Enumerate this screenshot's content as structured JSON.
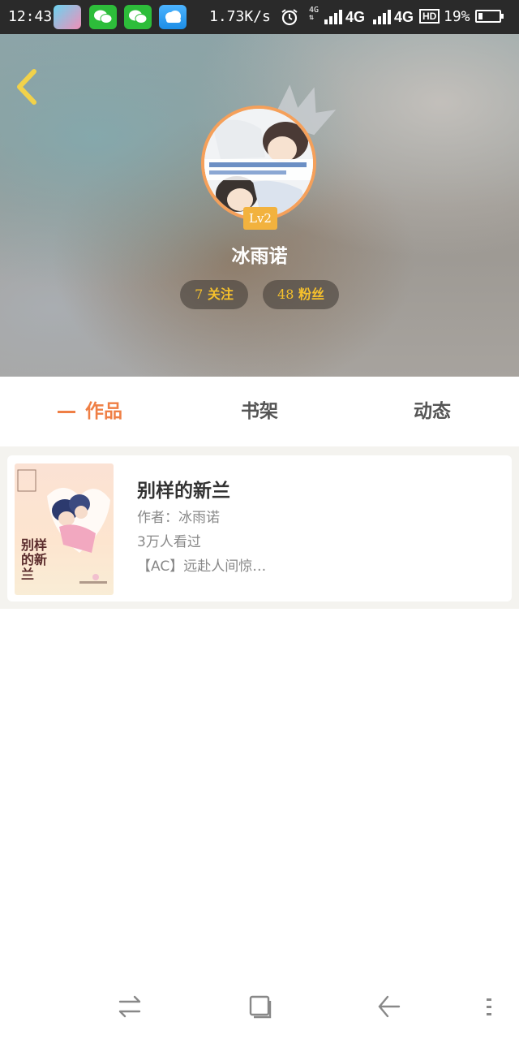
{
  "status_bar": {
    "time": "12:43",
    "net_speed": "1.73K/s",
    "net_label": "4G",
    "net_sub": "⇅",
    "carrier1": "4G",
    "carrier2": "4G",
    "hd": "HD",
    "battery_pct": "19%",
    "battery_level": 0.19
  },
  "header": {
    "back_icon": "chevron-left-icon",
    "level": "Lv2",
    "username": "冰雨诺",
    "follow_count": "7",
    "follow_label": " 关注",
    "fans_count": "48",
    "fans_label": " 粉丝"
  },
  "tabs": [
    {
      "label": "作品",
      "active": true
    },
    {
      "label": "书架",
      "active": false
    },
    {
      "label": "动态",
      "active": false
    }
  ],
  "books": [
    {
      "cover_title": "别样的新兰",
      "title": "别样的新兰",
      "author": "作者：冰雨诺",
      "views": "3万人看过",
      "description": "【AC】远赴人间惊…"
    }
  ],
  "colors": {
    "accent": "#ef7f45",
    "badge": "#f2b23e",
    "stat_text": "#f6c12c"
  }
}
